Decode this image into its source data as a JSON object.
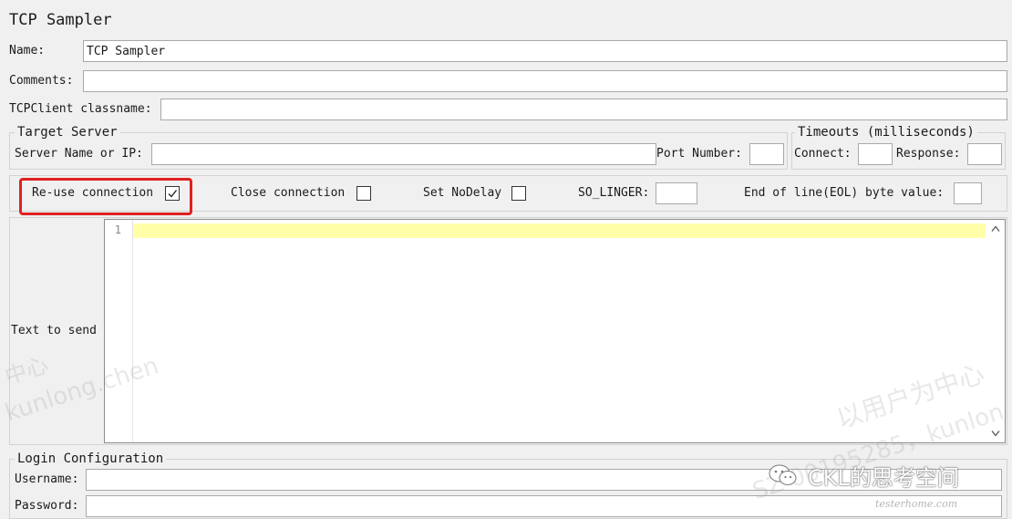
{
  "panel": {
    "title": "TCP Sampler"
  },
  "fields": {
    "name_label": "Name:",
    "name_value": "TCP Sampler",
    "comments_label": "Comments:",
    "comments_value": "",
    "classname_label": "TCPClient classname:",
    "classname_value": ""
  },
  "target_server": {
    "legend": "Target Server",
    "server_label": "Server Name or IP:",
    "server_value": "",
    "port_label": "Port Number:",
    "port_value": ""
  },
  "timeouts": {
    "legend": "Timeouts (milliseconds)",
    "connect_label": "Connect:",
    "connect_value": "",
    "response_label": "Response:",
    "response_value": ""
  },
  "options": {
    "reuse_label": "Re-use connection",
    "reuse_checked": true,
    "close_label": "Close connection",
    "close_checked": false,
    "nodelay_label": "Set NoDelay",
    "nodelay_checked": false,
    "solinger_label": "SO_LINGER:",
    "solinger_value": "",
    "eol_label": "End of line(EOL) byte value:",
    "eol_value": ""
  },
  "text_to_send": {
    "label": "Text to send",
    "line_number": "1"
  },
  "login": {
    "legend": "Login Configuration",
    "username_label": "Username:",
    "username_value": "",
    "password_label": "Password:",
    "password_value": ""
  },
  "annotation": {
    "highlight_color": "#e02020"
  },
  "watermark": {
    "left_cn": "中心",
    "left_en": "kunlong.chen",
    "right_cn": "以用户为中心",
    "right_en": "SZ 00195285，kunlon",
    "brand": "CKL的思考空间",
    "site": "testerhome.com"
  }
}
